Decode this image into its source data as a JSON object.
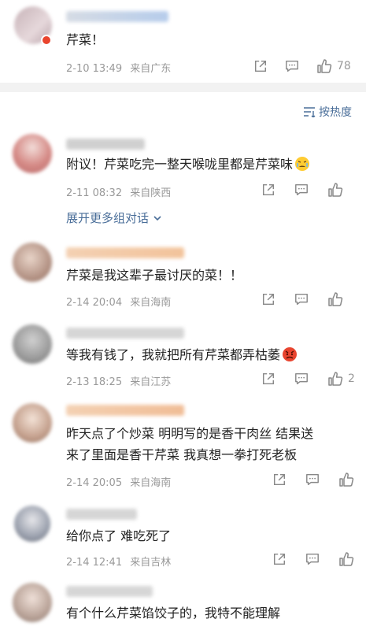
{
  "comments": [
    {
      "text": "芹菜！",
      "time": "2-10 13:49",
      "location": "来自广东",
      "likes": "78"
    },
    {
      "text": "附议！芹菜吃完一整天喉咙里都是芹菜味",
      "time": "2-11 08:32",
      "location": "来自陕西",
      "likes": ""
    },
    {
      "text": "芹菜是我这辈子最讨厌的菜！！",
      "time": "2-14 20:04",
      "location": "来自海南",
      "likes": ""
    },
    {
      "text": "等我有钱了，我就把所有芹菜都弄枯萎",
      "time": "2-13 18:25",
      "location": "来自江苏",
      "likes": "2"
    },
    {
      "text_lines": [
        "昨天点了个炒菜 明明写的是香干肉丝 结果送",
        "来了里面是香干芹菜 我真想一拳打死老板"
      ],
      "time": "2-14 20:05",
      "location": "来自海南",
      "likes": ""
    },
    {
      "text": "给你点了 难吃死了",
      "time": "2-14 12:41",
      "location": "来自吉林",
      "likes": ""
    },
    {
      "text": "有个什么芹菜馅饺子的，我特不能理解",
      "time": "",
      "location": "",
      "likes": ""
    }
  ],
  "sort_label": "按热度",
  "expand_label": "展开更多组对话",
  "colors": {
    "link": "#4a6e99",
    "meta": "#999999",
    "separator": "#f2f2f2"
  },
  "icons": [
    "share-icon",
    "comment-icon",
    "like-icon",
    "sort-icon",
    "chevron-down-icon",
    "weary-emoji-icon",
    "angry-emoji-icon"
  ]
}
